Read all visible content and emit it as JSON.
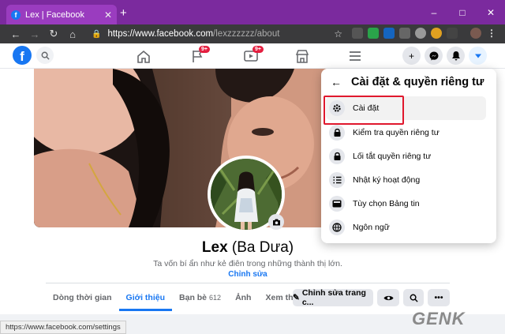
{
  "browser": {
    "tab_title": "Lex | Facebook",
    "new_tab": "+",
    "url_host": "https://www.facebook.com",
    "url_path": "/lexzzzzzz/about",
    "status_url": "https://www.facebook.com/settings",
    "window_controls": {
      "minimize": "–",
      "maximize": "□",
      "close": "✕"
    }
  },
  "header": {
    "logo": "f",
    "notifications_badge": "9+",
    "watch_badge": "9+"
  },
  "profile": {
    "name": "Lex",
    "alt_name": "(Ba Dưa)",
    "bio": "Ta vốn bí ẩn như kẻ điên trong những thành thị lớn.",
    "edit_bio": "Chỉnh sửa",
    "tabs": [
      {
        "label": "Dòng thời gian",
        "count": ""
      },
      {
        "label": "Giới thiệu",
        "count": ""
      },
      {
        "label": "Bạn bè",
        "count": "612"
      },
      {
        "label": "Ảnh",
        "count": ""
      },
      {
        "label": "Xem thêm ▾",
        "count": ""
      }
    ],
    "edit_profile_button": "Chỉnh sửa trang c..."
  },
  "dropdown": {
    "title": "Cài đặt & quyền riêng tư",
    "items": [
      {
        "label": "Cài đặt",
        "icon": "gear-icon"
      },
      {
        "label": "Kiểm tra quyền riêng tư",
        "icon": "lock-icon"
      },
      {
        "label": "Lối tắt quyền riêng tư",
        "icon": "lock-icon"
      },
      {
        "label": "Nhật ký hoạt động",
        "icon": "list-icon"
      },
      {
        "label": "Tùy chọn Bảng tin",
        "icon": "feed-icon"
      },
      {
        "label": "Ngôn ngữ",
        "icon": "globe-icon"
      }
    ]
  },
  "watermark": "GENK",
  "colors": {
    "brand": "#1877f2",
    "tabbar": "#7b2a9e",
    "highlight": "#e0182d"
  }
}
